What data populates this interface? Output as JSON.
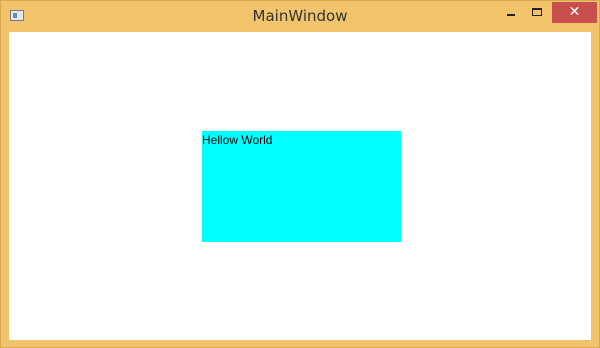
{
  "window": {
    "title": "MainWindow",
    "close_glyph": "✕",
    "icons": {
      "app": "app-window-icon",
      "minimize": "minimize-icon",
      "maximize": "maximize-icon",
      "close": "close-icon"
    },
    "colors": {
      "frame": "#f1c46b",
      "close_button": "#c7504c",
      "client_background": "#ffffff"
    }
  },
  "content": {
    "label_text": "Hellow World",
    "label_background": "#00ffff"
  }
}
